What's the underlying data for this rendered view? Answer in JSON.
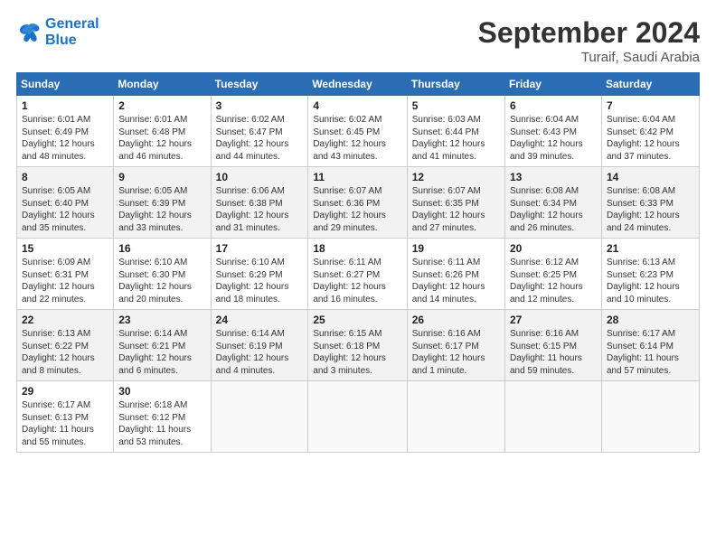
{
  "header": {
    "logo_line1": "General",
    "logo_line2": "Blue",
    "month_title": "September 2024",
    "subtitle": "Turaif, Saudi Arabia"
  },
  "weekdays": [
    "Sunday",
    "Monday",
    "Tuesday",
    "Wednesday",
    "Thursday",
    "Friday",
    "Saturday"
  ],
  "weeks": [
    [
      {
        "day": "1",
        "sunrise": "6:01 AM",
        "sunset": "6:49 PM",
        "daylight": "12 hours and 48 minutes."
      },
      {
        "day": "2",
        "sunrise": "6:01 AM",
        "sunset": "6:48 PM",
        "daylight": "12 hours and 46 minutes."
      },
      {
        "day": "3",
        "sunrise": "6:02 AM",
        "sunset": "6:47 PM",
        "daylight": "12 hours and 44 minutes."
      },
      {
        "day": "4",
        "sunrise": "6:02 AM",
        "sunset": "6:45 PM",
        "daylight": "12 hours and 43 minutes."
      },
      {
        "day": "5",
        "sunrise": "6:03 AM",
        "sunset": "6:44 PM",
        "daylight": "12 hours and 41 minutes."
      },
      {
        "day": "6",
        "sunrise": "6:04 AM",
        "sunset": "6:43 PM",
        "daylight": "12 hours and 39 minutes."
      },
      {
        "day": "7",
        "sunrise": "6:04 AM",
        "sunset": "6:42 PM",
        "daylight": "12 hours and 37 minutes."
      }
    ],
    [
      {
        "day": "8",
        "sunrise": "6:05 AM",
        "sunset": "6:40 PM",
        "daylight": "12 hours and 35 minutes."
      },
      {
        "day": "9",
        "sunrise": "6:05 AM",
        "sunset": "6:39 PM",
        "daylight": "12 hours and 33 minutes."
      },
      {
        "day": "10",
        "sunrise": "6:06 AM",
        "sunset": "6:38 PM",
        "daylight": "12 hours and 31 minutes."
      },
      {
        "day": "11",
        "sunrise": "6:07 AM",
        "sunset": "6:36 PM",
        "daylight": "12 hours and 29 minutes."
      },
      {
        "day": "12",
        "sunrise": "6:07 AM",
        "sunset": "6:35 PM",
        "daylight": "12 hours and 27 minutes."
      },
      {
        "day": "13",
        "sunrise": "6:08 AM",
        "sunset": "6:34 PM",
        "daylight": "12 hours and 26 minutes."
      },
      {
        "day": "14",
        "sunrise": "6:08 AM",
        "sunset": "6:33 PM",
        "daylight": "12 hours and 24 minutes."
      }
    ],
    [
      {
        "day": "15",
        "sunrise": "6:09 AM",
        "sunset": "6:31 PM",
        "daylight": "12 hours and 22 minutes."
      },
      {
        "day": "16",
        "sunrise": "6:10 AM",
        "sunset": "6:30 PM",
        "daylight": "12 hours and 20 minutes."
      },
      {
        "day": "17",
        "sunrise": "6:10 AM",
        "sunset": "6:29 PM",
        "daylight": "12 hours and 18 minutes."
      },
      {
        "day": "18",
        "sunrise": "6:11 AM",
        "sunset": "6:27 PM",
        "daylight": "12 hours and 16 minutes."
      },
      {
        "day": "19",
        "sunrise": "6:11 AM",
        "sunset": "6:26 PM",
        "daylight": "12 hours and 14 minutes."
      },
      {
        "day": "20",
        "sunrise": "6:12 AM",
        "sunset": "6:25 PM",
        "daylight": "12 hours and 12 minutes."
      },
      {
        "day": "21",
        "sunrise": "6:13 AM",
        "sunset": "6:23 PM",
        "daylight": "12 hours and 10 minutes."
      }
    ],
    [
      {
        "day": "22",
        "sunrise": "6:13 AM",
        "sunset": "6:22 PM",
        "daylight": "12 hours and 8 minutes."
      },
      {
        "day": "23",
        "sunrise": "6:14 AM",
        "sunset": "6:21 PM",
        "daylight": "12 hours and 6 minutes."
      },
      {
        "day": "24",
        "sunrise": "6:14 AM",
        "sunset": "6:19 PM",
        "daylight": "12 hours and 4 minutes."
      },
      {
        "day": "25",
        "sunrise": "6:15 AM",
        "sunset": "6:18 PM",
        "daylight": "12 hours and 3 minutes."
      },
      {
        "day": "26",
        "sunrise": "6:16 AM",
        "sunset": "6:17 PM",
        "daylight": "12 hours and 1 minute."
      },
      {
        "day": "27",
        "sunrise": "6:16 AM",
        "sunset": "6:15 PM",
        "daylight": "11 hours and 59 minutes."
      },
      {
        "day": "28",
        "sunrise": "6:17 AM",
        "sunset": "6:14 PM",
        "daylight": "11 hours and 57 minutes."
      }
    ],
    [
      {
        "day": "29",
        "sunrise": "6:17 AM",
        "sunset": "6:13 PM",
        "daylight": "11 hours and 55 minutes."
      },
      {
        "day": "30",
        "sunrise": "6:18 AM",
        "sunset": "6:12 PM",
        "daylight": "11 hours and 53 minutes."
      },
      null,
      null,
      null,
      null,
      null
    ]
  ]
}
